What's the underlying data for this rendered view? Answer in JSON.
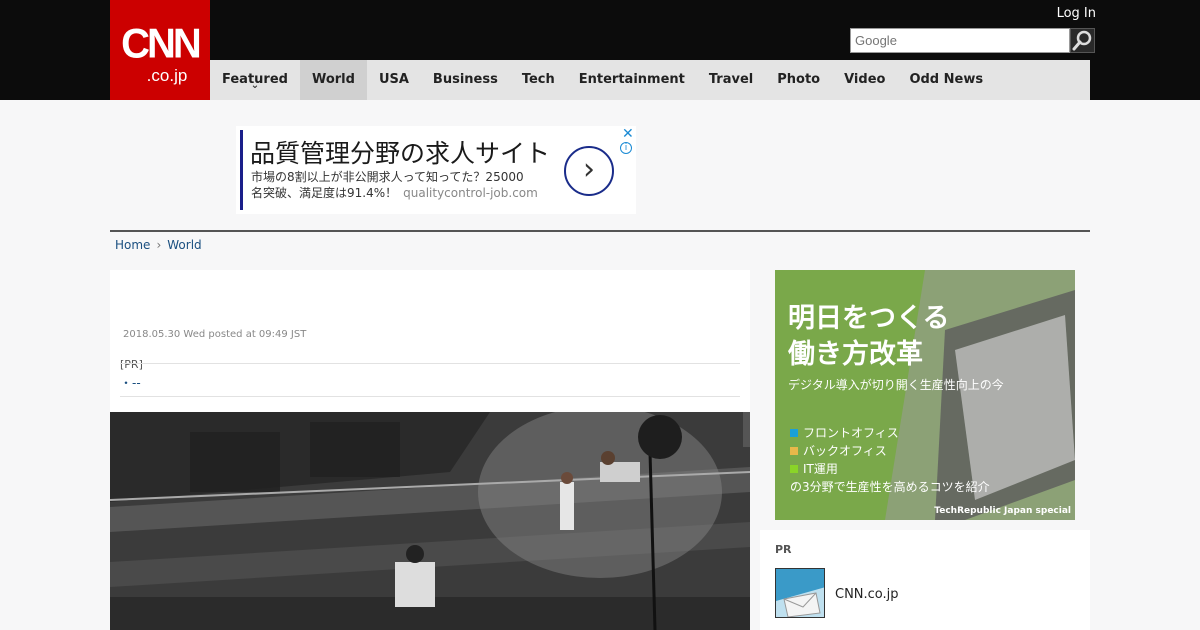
{
  "header": {
    "logo_main": "CNN",
    "logo_sub": ".co.jp",
    "login": "Log In",
    "search_placeholder": "Google",
    "nav": [
      {
        "label": "Featured",
        "active": false
      },
      {
        "label": "World",
        "active": true
      },
      {
        "label": "USA",
        "active": false
      },
      {
        "label": "Business",
        "active": false
      },
      {
        "label": "Tech",
        "active": false
      },
      {
        "label": "Entertainment",
        "active": false
      },
      {
        "label": "Travel",
        "active": false
      },
      {
        "label": "Photo",
        "active": false
      },
      {
        "label": "Video",
        "active": false
      },
      {
        "label": "Odd News",
        "active": false
      }
    ]
  },
  "top_ad": {
    "title": "品質管理分野の求人サイト",
    "line1": "市場の8割以上が非公開求人って知ってた？25000",
    "line2": "名突破、満足度は91.4%！",
    "url": "qualitycontrol-job.com",
    "close": "✕",
    "info": "i"
  },
  "breadcrumb": {
    "home": "Home",
    "section": "World"
  },
  "article": {
    "date": "2018.05.30 Wed posted at 09:49 JST",
    "pr_label": "[PR]",
    "pr_link": "・--"
  },
  "side_ad": {
    "title1": "明日をつくる",
    "title2": "働き方改革",
    "subtitle": "デジタル導入が切り開く生産性向上の今",
    "items": [
      "フロントオフィス",
      "バックオフィス",
      "IT運用"
    ],
    "item_colors": [
      "#1aa0d8",
      "#e8b84a",
      "#8ad428"
    ],
    "tagline": "の3分野で生産性を高めるコツを紹介",
    "footer": "TechRepublic Japan special"
  },
  "pr_box": {
    "label": "PR",
    "name": "CNN.co.jp"
  },
  "colors": {
    "brand_red": "#cc0000",
    "link_blue": "#1a4f80",
    "nav_bg": "#e4e4e4"
  }
}
